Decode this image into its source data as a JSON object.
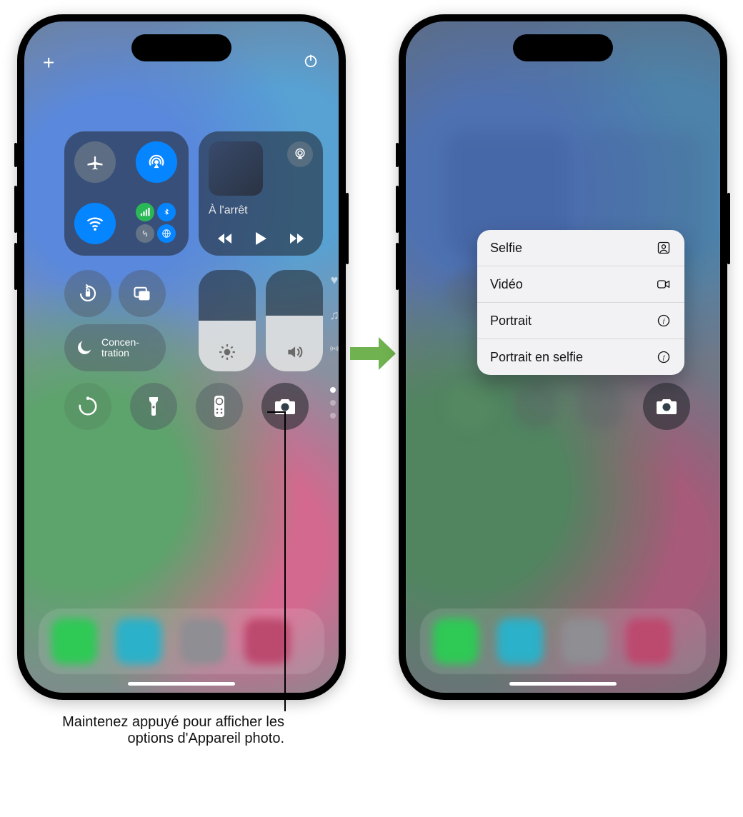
{
  "left": {
    "plus_label": "+",
    "media": {
      "status": "À l'arrêt"
    },
    "focus": {
      "label": "Concen-\ntration"
    },
    "brightness_level": 0.5,
    "volume_level": 0.55
  },
  "context_menu": {
    "items": [
      {
        "label": "Selfie",
        "icon": "person-square-icon"
      },
      {
        "label": "Vidéo",
        "icon": "video-icon"
      },
      {
        "label": "Portrait",
        "icon": "aperture-icon"
      },
      {
        "label": "Portrait en selfie",
        "icon": "aperture-icon"
      }
    ]
  },
  "caption": "Maintenez appuyé pour afficher les options d'Appareil photo.",
  "icons": {
    "airplane": "airplane-icon",
    "airdrop": "airdrop-icon",
    "wifi": "wifi-icon",
    "cellular": "signal-icon",
    "bluetooth": "bluetooth-icon",
    "hotspot": "link-icon",
    "satellite": "globe-icon",
    "airplay": "airplay-icon",
    "rewind": "rewind-icon",
    "play": "play-icon",
    "forward": "forward-icon",
    "lock": "rotation-lock-icon",
    "mirror": "screen-mirror-icon",
    "moon": "moon-icon",
    "sun": "sun-icon",
    "speaker": "speaker-icon",
    "heart": "heart-icon",
    "music": "music-note-icon",
    "antenna": "antenna-icon",
    "timer": "timer-icon",
    "torch": "flashlight-icon",
    "remote": "apple-tv-remote-icon",
    "camera": "camera-icon",
    "power": "power-icon"
  }
}
